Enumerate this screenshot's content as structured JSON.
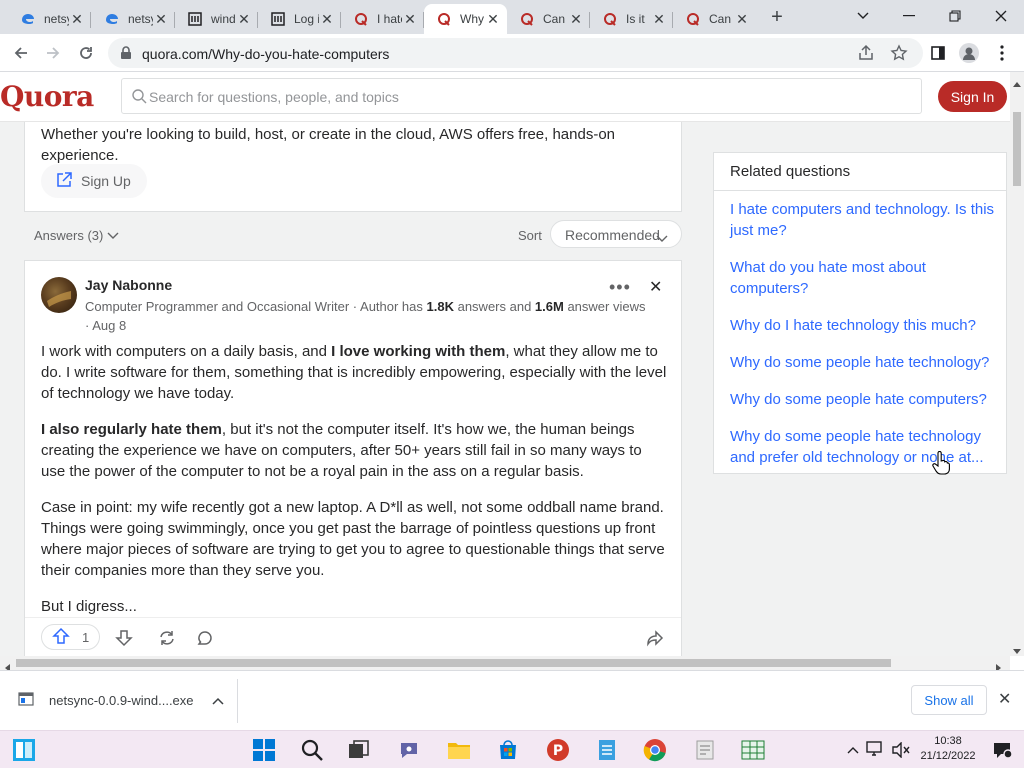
{
  "browser": {
    "tabs": [
      {
        "title": "netsync",
        "icon": "edge-logo-icon"
      },
      {
        "title": "netsync",
        "icon": "edge-logo-icon"
      },
      {
        "title": "windows",
        "icon": "museum-icon"
      },
      {
        "title": "Log in",
        "icon": "museum-icon"
      },
      {
        "title": "I hate",
        "icon": "quora-icon"
      },
      {
        "title": "Why do",
        "icon": "quora-icon",
        "active": true
      },
      {
        "title": "Can",
        "icon": "quora-icon"
      },
      {
        "title": "Is it",
        "icon": "quora-icon"
      },
      {
        "title": "Can you",
        "icon": "quora-icon"
      }
    ],
    "url": "quora.com/Why-do-you-hate-computers"
  },
  "quora": {
    "logo": "Quora",
    "search_placeholder": "Search for questions, people, and topics",
    "signin_label": "Sign In",
    "brand_color": "#b92b27",
    "link_color": "#2e69ff"
  },
  "ad": {
    "text": "Whether you're looking to build, host, or create in the cloud, AWS offers free, hands-on experience.",
    "button_label": "Sign Up"
  },
  "answers_bar": {
    "count_label": "Answers (3)",
    "sort_label": "Sort",
    "sort_value": "Recommended"
  },
  "answer": {
    "author": "Jay Nabonne",
    "credential_prefix": "Computer Programmer and Occasional Writer · Author has ",
    "answers_count": "1.8K",
    "answers_mid": " answers and ",
    "views_count": "1.6M",
    "views_suffix": " answer views · ",
    "date": "Aug 8",
    "p1_a": "I work with computers on a daily basis, and ",
    "p1_bold": "I love working with them",
    "p1_b": ", what they allow me to do. I write software for them, something that is incredibly empowering, especially with the level of technology we have today.",
    "p2_bold": "I also regularly hate them",
    "p2_b": ", but it's not the computer itself. It's how we, the human beings creating the experience we have on computers, after 50+ years still fail in so many ways to use the power of the computer to not be a royal pain in the ass on a regular basis.",
    "p3": "Case in point: my wife recently got a new laptop. A D*ll as well, not some oddball name brand. Things were going swimmingly, once you get past the barrage of pointless questions up front where major pieces of software are trying to get you to agree to questionable things that serve their companies more than they serve you.",
    "p4": "But I digress...",
    "upvotes": "1"
  },
  "related": {
    "title": "Related questions",
    "items": [
      "I hate computers and technology. Is this just me?",
      "What do you hate most about computers?",
      "Why do I hate technology this much?",
      "Why do some people hate technology?",
      "Why do some people hate computers?",
      "Why do some people hate technology and prefer old technology or none at..."
    ]
  },
  "download": {
    "filename": "netsync-0.0.9-wind....exe",
    "show_all": "Show all"
  },
  "taskbar": {
    "time": "10:38",
    "date": "21/12/2022"
  }
}
